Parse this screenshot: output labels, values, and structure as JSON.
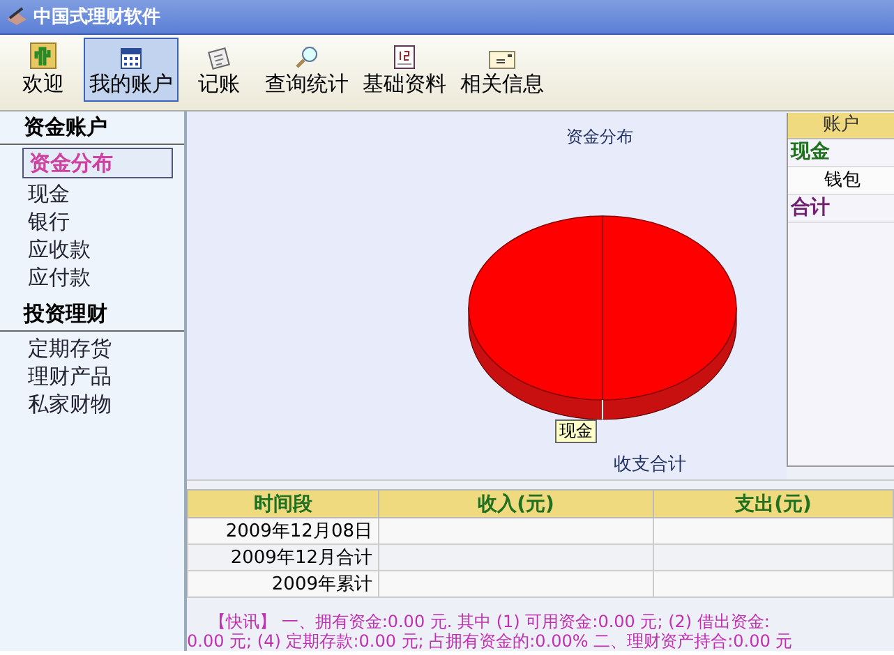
{
  "window": {
    "title": "中国式理财软件"
  },
  "toolbar": [
    {
      "label": "欢迎",
      "selected": false
    },
    {
      "label": "我的账户",
      "selected": true
    },
    {
      "label": "记账",
      "selected": false
    },
    {
      "label": "查询统计",
      "selected": false
    },
    {
      "label": "基础资料",
      "selected": false
    },
    {
      "label": "相关信息",
      "selected": false
    }
  ],
  "sidebar": {
    "groups": [
      {
        "title": "资金账户",
        "items": [
          {
            "label": "资金分布",
            "selected": true
          },
          {
            "label": "现金",
            "selected": false
          },
          {
            "label": "银行",
            "selected": false
          },
          {
            "label": "应收款",
            "selected": false
          },
          {
            "label": "应付款",
            "selected": false
          }
        ]
      },
      {
        "title": "投资理财",
        "items": [
          {
            "label": "定期存货",
            "selected": false
          },
          {
            "label": "理财产品",
            "selected": false
          },
          {
            "label": "私家财物",
            "selected": false
          }
        ]
      }
    ]
  },
  "chart": {
    "title": "资金分布",
    "slice_label": "现金",
    "footer": "收支合计"
  },
  "accounts": {
    "header": "账户",
    "rows": [
      {
        "kind": "group",
        "label": "现金"
      },
      {
        "kind": "item",
        "label": "钱包"
      },
      {
        "kind": "total",
        "label": "合计"
      }
    ]
  },
  "table": {
    "columns": [
      "时间段",
      "收入(元)",
      "支出(元)"
    ],
    "rows": [
      [
        "2009年12月08日"
      ],
      [
        "2009年12月合计"
      ],
      [
        "2009年累计"
      ]
    ]
  },
  "news": [
    "【快讯】  一、拥有资金:0.00 元. 其中 (1) 可用资金:0.00 元; (2) 借出资金:",
    "0.00 元; (4) 定期存款:0.00 元; 占拥有资金的:0.00%  二、理财资产持合:0.00 元"
  ]
}
